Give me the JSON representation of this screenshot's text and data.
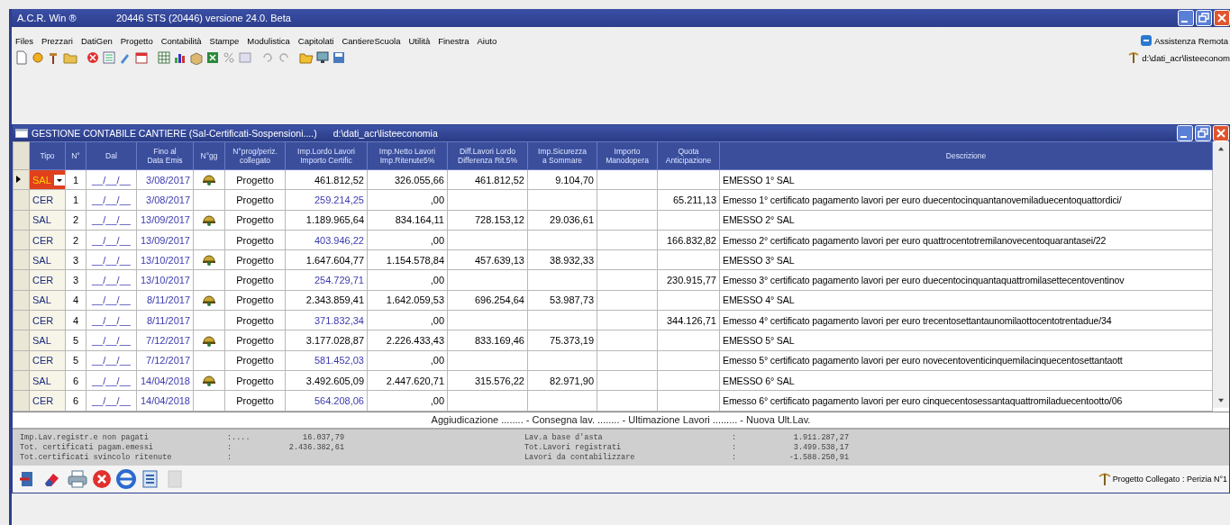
{
  "window": {
    "app_name": "A.C.R. Win ®",
    "title": "20446 STS (20446) versione 24.0. Beta"
  },
  "menu": [
    "Files",
    "Prezzari",
    "DatiGen",
    "Progetto",
    "Contabilità",
    "Stampe",
    "Modulistica",
    "Capitolati",
    "CantiereScuola",
    "Utilità",
    "Finestra",
    "Aiuto"
  ],
  "remote_assistance": "Assistenza Remota",
  "path": "d:\\dati_acr\\listeeconom",
  "child_window": {
    "title": "GESTIONE CONTABILE CANTIERE (Sal-Certificati-Sospensioni....)",
    "path": "d:\\dati_acr\\listeeconomia"
  },
  "table": {
    "columns": [
      "Tipo",
      "N°",
      "Dal",
      "Fino al\nData Emis",
      "N°gg",
      "N°prog/periz.\ncollegato",
      "Imp.Lordo Lavori\nImporto Certific",
      "Imp.Netto Lavori\nImp.Ritenute5%",
      "Diff.Lavori Lordo\nDifferenza Rit.5%",
      "Imp.Sicurezza\na Sommare",
      "Importo\nManodopera",
      "Quota\nAnticipazione",
      "Descrizione"
    ],
    "rows": [
      {
        "tipo": "SAL",
        "kind": "sal",
        "selected": true,
        "n": "1",
        "dal": "__/__/__",
        "fino": "3/08/2017",
        "helmet": true,
        "collegato": "Progetto",
        "imp_lordo": "461.812,52",
        "imp_netto": "326.055,66",
        "diff": "461.812,52",
        "sicurezza": "9.104,70",
        "descrizione": "EMESSO 1° SAL"
      },
      {
        "tipo": "CER",
        "kind": "cer",
        "selected": false,
        "n": "1",
        "dal": "__/__/__",
        "fino": "3/08/2017",
        "helmet": false,
        "collegato": "Progetto",
        "imp_lordo": "259.214,25",
        "imp_netto": ",00",
        "quota": "65.211,13",
        "descrizione": "Emesso 1° certificato pagamento lavori per euro duecentocinquantanovemiladuecentoquattordici/"
      },
      {
        "tipo": "SAL",
        "kind": "sal",
        "selected": false,
        "n": "2",
        "dal": "__/__/__",
        "fino": "13/09/2017",
        "helmet": true,
        "collegato": "Progetto",
        "imp_lordo": "1.189.965,64",
        "imp_netto": "834.164,11",
        "diff": "728.153,12",
        "sicurezza": "29.036,61",
        "descrizione": "EMESSO 2° SAL"
      },
      {
        "tipo": "CER",
        "kind": "cer",
        "selected": false,
        "n": "2",
        "dal": "__/__/__",
        "fino": "13/09/2017",
        "helmet": false,
        "collegato": "Progetto",
        "imp_lordo": "403.946,22",
        "imp_netto": ",00",
        "quota": "166.832,82",
        "descrizione": "Emesso 2° certificato pagamento lavori per euro quattrocentotremilanovecentoquarantasei/22"
      },
      {
        "tipo": "SAL",
        "kind": "sal",
        "selected": false,
        "n": "3",
        "dal": "__/__/__",
        "fino": "13/10/2017",
        "helmet": true,
        "collegato": "Progetto",
        "imp_lordo": "1.647.604,77",
        "imp_netto": "1.154.578,84",
        "diff": "457.639,13",
        "sicurezza": "38.932,33",
        "descrizione": "EMESSO 3° SAL"
      },
      {
        "tipo": "CER",
        "kind": "cer",
        "selected": false,
        "n": "3",
        "dal": "__/__/__",
        "fino": "13/10/2017",
        "helmet": false,
        "collegato": "Progetto",
        "imp_lordo": "254.729,71",
        "imp_netto": ",00",
        "quota": "230.915,77",
        "descrizione": "Emesso 3° certificato pagamento lavori per euro duecentocinquantaquattromilasettecentoventinov"
      },
      {
        "tipo": "SAL",
        "kind": "sal",
        "selected": false,
        "n": "4",
        "dal": "__/__/__",
        "fino": "8/11/2017",
        "helmet": true,
        "collegato": "Progetto",
        "imp_lordo": "2.343.859,41",
        "imp_netto": "1.642.059,53",
        "diff": "696.254,64",
        "sicurezza": "53.987,73",
        "descrizione": "EMESSO 4° SAL"
      },
      {
        "tipo": "CER",
        "kind": "cer",
        "selected": false,
        "n": "4",
        "dal": "__/__/__",
        "fino": "8/11/2017",
        "helmet": false,
        "collegato": "Progetto",
        "imp_lordo": "371.832,34",
        "imp_netto": ",00",
        "quota": "344.126,71",
        "descrizione": "Emesso 4° certificato pagamento lavori per euro trecentosettantaunomilaottocentotrentadue/34"
      },
      {
        "tipo": "SAL",
        "kind": "sal",
        "selected": false,
        "n": "5",
        "dal": "__/__/__",
        "fino": "7/12/2017",
        "helmet": true,
        "collegato": "Progetto",
        "imp_lordo": "3.177.028,87",
        "imp_netto": "2.226.433,43",
        "diff": "833.169,46",
        "sicurezza": "75.373,19",
        "descrizione": "EMESSO 5° SAL"
      },
      {
        "tipo": "CER",
        "kind": "cer",
        "selected": false,
        "n": "5",
        "dal": "__/__/__",
        "fino": "7/12/2017",
        "helmet": false,
        "collegato": "Progetto",
        "imp_lordo": "581.452,03",
        "imp_netto": ",00",
        "descrizione": "Emesso 5° certificato pagamento lavori per euro novecentoventicinquemilacinquecentosettantaott"
      },
      {
        "tipo": "SAL",
        "kind": "sal",
        "selected": false,
        "n": "6",
        "dal": "__/__/__",
        "fino": "14/04/2018",
        "helmet": true,
        "collegato": "Progetto",
        "imp_lordo": "3.492.605,09",
        "imp_netto": "2.447.620,71",
        "diff": "315.576,22",
        "sicurezza": "82.971,90",
        "descrizione": "EMESSO 6° SAL"
      },
      {
        "tipo": "CER",
        "kind": "cer",
        "selected": false,
        "n": "6",
        "dal": "__/__/__",
        "fino": "14/04/2018",
        "helmet": false,
        "collegato": "Progetto",
        "imp_lordo": "564.208,06",
        "imp_netto": ",00",
        "descrizione": "Emesso 6° certificato pagamento lavori per euro cinquecentosessantaquattromiladuecentootto/06"
      }
    ]
  },
  "dates_line": "Aggiudicazione ........ - Consegna lav. ........ - Ultimazione Lavori ......... - Nuova Ult.Lav.",
  "summary": [
    {
      "label": "Imp.Lav.registr.e non pagati",
      "sep": ":....",
      "value": "16.037,79"
    },
    {
      "label": "Tot. certificati pagam.emessi",
      "sep": ":",
      "value": "2.436.382,61"
    },
    {
      "label": "Tot.certificati svincolo ritenute",
      "sep": ":"
    },
    {
      "label": "Lav.a base d'asta",
      "sep": ":",
      "value": "1.911.287,27"
    },
    {
      "label": "Tot.Lavori registrati",
      "sep": ":",
      "value": "3.499.538,17"
    },
    {
      "label": "Lavori da contabilizzare",
      "sep": ":",
      "value": "-1.588.250,91"
    }
  ],
  "status": "Progetto Collegato : Perizia N°1"
}
